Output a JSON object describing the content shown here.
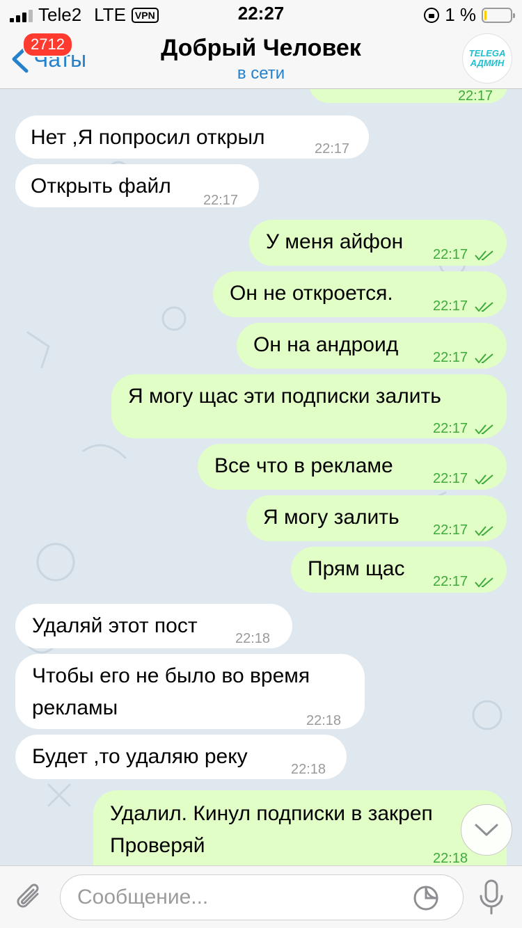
{
  "status_bar": {
    "carrier": "Tele2",
    "network": "LTE",
    "vpn": "VPN",
    "time": "22:27",
    "battery": "1 %"
  },
  "header": {
    "back_label": "Чаты",
    "unread_badge": "2712",
    "contact_name": "Добрый Человек",
    "contact_status": "в сети",
    "avatar_text_line1": "TELEGA",
    "avatar_text_line2": "АДМИН"
  },
  "messages": [
    {
      "dir": "out",
      "text": "",
      "time": "22:17"
    },
    {
      "dir": "in",
      "text": "Нет ,Я попросил открыл",
      "time": "22:17"
    },
    {
      "dir": "in",
      "text": "Открыть файл",
      "time": "22:17"
    },
    {
      "dir": "out",
      "text": "У меня айфон",
      "time": "22:17"
    },
    {
      "dir": "out",
      "text": "Он не откроется.",
      "time": "22:17"
    },
    {
      "dir": "out",
      "text": "Он на андроид",
      "time": "22:17"
    },
    {
      "dir": "out",
      "text": "Я могу щас эти подписки залить",
      "time": "22:17"
    },
    {
      "dir": "out",
      "text": "Все что в рекламе",
      "time": "22:17"
    },
    {
      "dir": "out",
      "text": "Я могу залить",
      "time": "22:17"
    },
    {
      "dir": "out",
      "text": "Прям щас",
      "time": "22:17"
    },
    {
      "dir": "in",
      "text": "Удаляй этот пост",
      "time": "22:18"
    },
    {
      "dir": "in",
      "text_line1": "Чтобы его не было во время",
      "text_line2": "рекламы",
      "time": "22:18"
    },
    {
      "dir": "in",
      "text": "Будет ,то удаляю реку",
      "time": "22:18"
    },
    {
      "dir": "out",
      "text_line1": "Удалил. Кинул подписки в закреп",
      "text_line2": "Проверяй",
      "time": "22:18"
    }
  ],
  "input": {
    "placeholder": "Сообщение..."
  },
  "colors": {
    "accent": "#2481cc",
    "outgoing_bubble": "#e1fec6",
    "incoming_bubble": "#ffffff",
    "chat_background": "#dfe8ef",
    "badge": "#ff3b30",
    "read_ticks": "#3eaa3c"
  },
  "icons": {
    "back": "chevron-left-icon",
    "attach": "paperclip-icon",
    "sticker": "sticker-icon",
    "mic": "microphone-icon",
    "scroll": "chevron-down-icon",
    "read": "double-check-icon"
  }
}
